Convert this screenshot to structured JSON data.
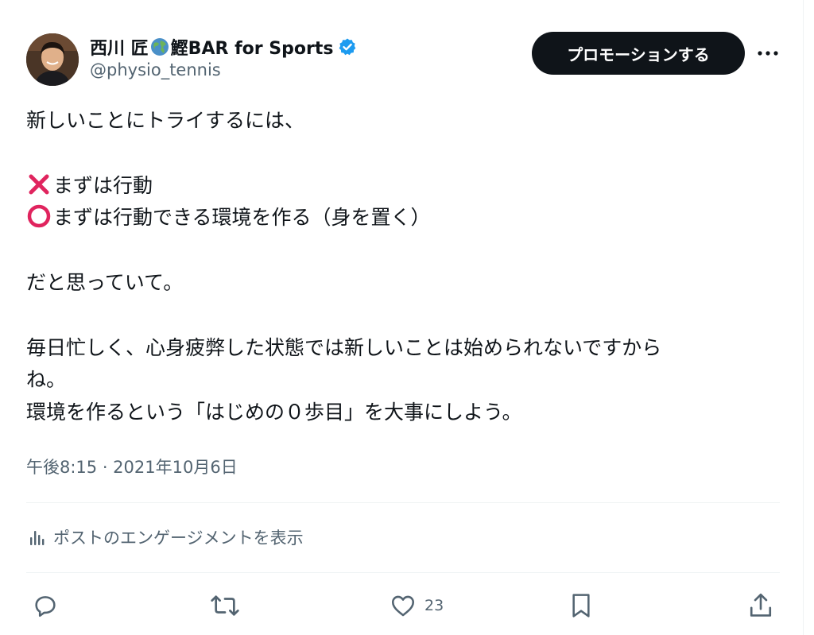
{
  "author": {
    "name_part1": "西川 匠",
    "name_part2": "鰹BAR for Sports",
    "handle": "@physio_tennis",
    "verified": true,
    "avatar_icon": "user-photo"
  },
  "header": {
    "promote_label": "プロモーションする",
    "more_icon": "more-horizontal-icon"
  },
  "tweet": {
    "line1": "新しいことにトライするには、",
    "line2": "まずは行動",
    "line2_icon": "cross-mark-icon",
    "line3": "まずは行動できる環境を作る（身を置く）",
    "line3_icon": "circle-mark-icon",
    "line4": "だと思っていて。",
    "line5": "毎日忙しく、心身疲弊した状態では新しいことは始められないですから",
    "line6": "ね。",
    "line7": "環境を作るという「はじめの０歩目」を大事にしよう。",
    "timestamp": "午後8:15 · 2021年10月6日"
  },
  "analytics": {
    "label": "ポストのエンゲージメントを表示",
    "icon": "bar-chart-icon"
  },
  "actions": {
    "reply_icon": "reply-icon",
    "retweet_icon": "retweet-icon",
    "like_icon": "heart-icon",
    "like_count": "23",
    "bookmark_icon": "bookmark-icon",
    "share_icon": "share-icon"
  },
  "colors": {
    "text_primary": "#0f1419",
    "text_secondary": "#536471",
    "verified_blue": "#1d9bf0",
    "divider": "#eff3f4",
    "cross_red": "#e0245e",
    "circle_red": "#e0245e"
  }
}
